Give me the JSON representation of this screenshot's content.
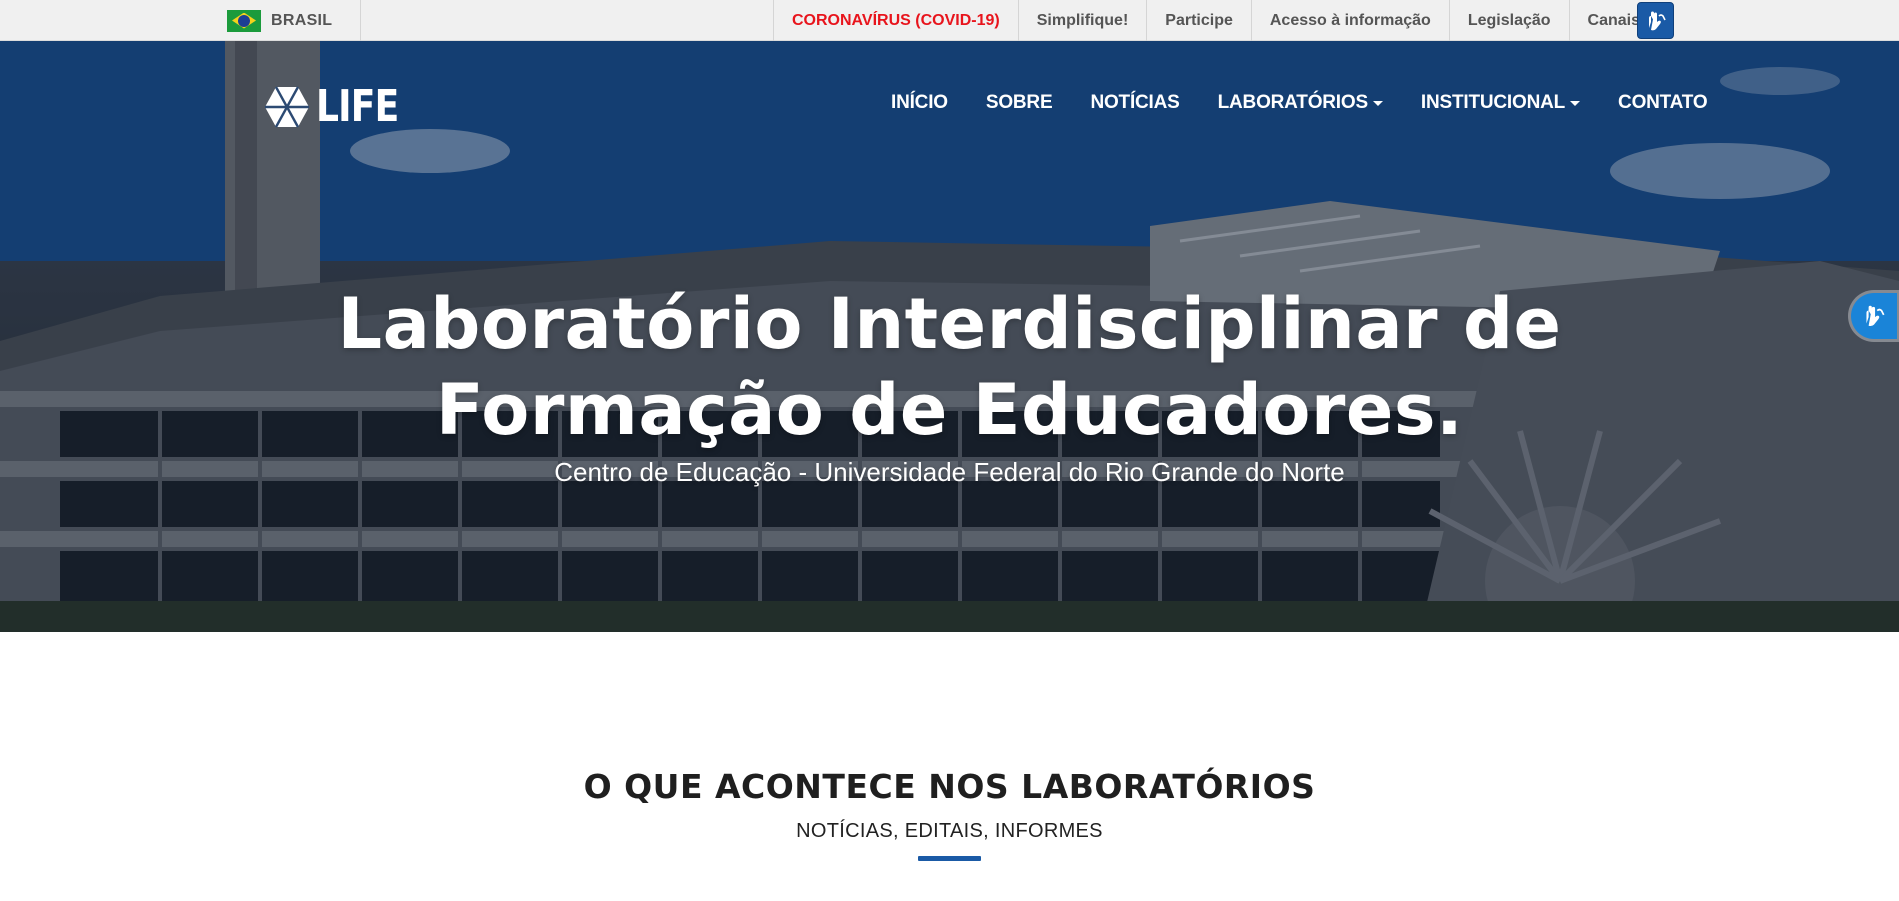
{
  "govbar": {
    "country_label": "BRASIL",
    "links": [
      {
        "label": "CORONAVÍRUS (COVID-19)",
        "highlight": true
      },
      {
        "label": "Simplifique!"
      },
      {
        "label": "Participe"
      },
      {
        "label": "Acesso à informação"
      },
      {
        "label": "Legislação"
      },
      {
        "label": "Canais"
      }
    ],
    "highlight_color": "#e8141c"
  },
  "header": {
    "logo_text": "LIFE",
    "nav": [
      {
        "label": "INÍCIO",
        "dropdown": false
      },
      {
        "label": "SOBRE",
        "dropdown": false
      },
      {
        "label": "NOTÍCIAS",
        "dropdown": false
      },
      {
        "label": "LABORATÓRIOS",
        "dropdown": true
      },
      {
        "label": "INSTITUCIONAL",
        "dropdown": true
      },
      {
        "label": "CONTATO",
        "dropdown": false
      }
    ]
  },
  "hero": {
    "title_line1": "Laboratório Interdisciplinar de",
    "title_line2": "Formação de Educadores.",
    "subtitle": "Centro de Educação - Universidade Federal do Rio Grande do Norte"
  },
  "section": {
    "title": "O QUE ACONTECE NOS LABORATÓRIOS",
    "subtitle": "NOTÍCIAS, EDITAIS, INFORMES",
    "accent_color": "#1a5aa6"
  },
  "icons": {
    "flag": "brazil-flag-icon",
    "accessibility": "vlibras-hands-icon",
    "logo_mark": "hexagon-logo-icon"
  }
}
